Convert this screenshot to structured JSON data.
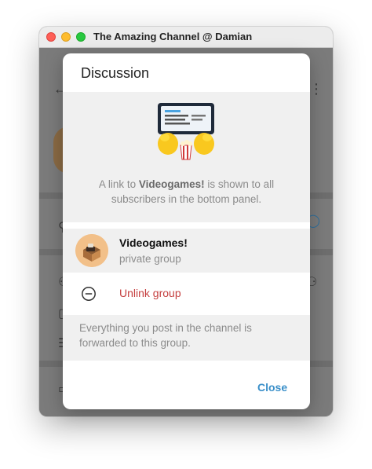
{
  "window": {
    "title": "The Amazing Channel @ Damian"
  },
  "dialog": {
    "title": "Discussion",
    "hero": {
      "text_before": "A link to ",
      "group_name": "Videogames!",
      "text_after": " is shown to all subscribers in the bottom panel."
    },
    "group": {
      "name": "Videogames!",
      "status": "private group"
    },
    "unlink_label": "Unlink group",
    "footer_text": "Everything you post in the channel is forwarded to this group.",
    "close_label": "Close"
  },
  "colors": {
    "accent": "#3a8fc9",
    "danger": "#c53f3f",
    "muted_text": "#8b8b8b",
    "panel_bg": "#f0f0f0"
  },
  "icons": {
    "hero": "duck-holding-tablet-sticker",
    "unlink": "minus-circle-icon",
    "group_avatar": "treasure-chest-avatar"
  }
}
